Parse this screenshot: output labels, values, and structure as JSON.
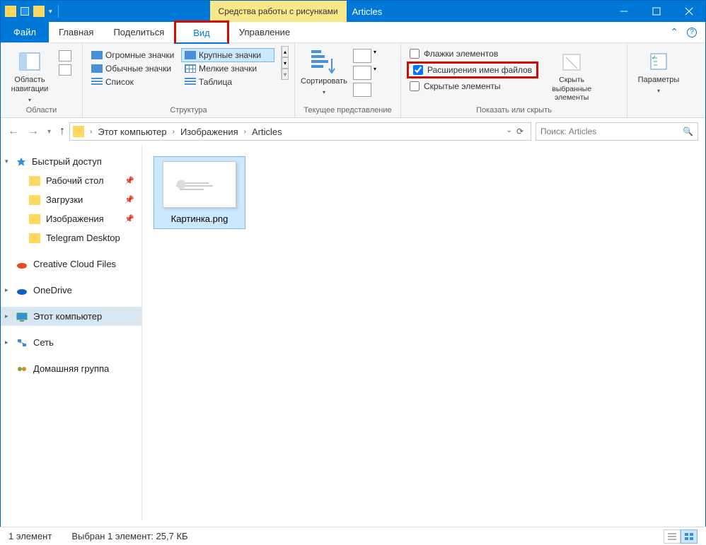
{
  "title_bar": {
    "context_label": "Средства работы с рисунками",
    "app_title": "Articles"
  },
  "tabs": {
    "file": "Файл",
    "home": "Главная",
    "share": "Поделиться",
    "view": "Вид",
    "manage": "Управление"
  },
  "ribbon": {
    "areas": {
      "nav_pane": "Область навигации",
      "group_label": "Области"
    },
    "layouts": {
      "huge": "Огромные значки",
      "large": "Крупные значки",
      "normal": "Обычные значки",
      "small": "Мелкие значки",
      "list": "Список",
      "table": "Таблица",
      "group_label": "Структура"
    },
    "current_view": {
      "sort": "Сортировать",
      "group_label": "Текущее представление"
    },
    "show_hide": {
      "item_checkboxes": "Флажки элементов",
      "file_ext": "Расширения имен файлов",
      "hidden": "Скрытые элементы",
      "hide_selected": "Скрыть выбранные элементы",
      "group_label": "Показать или скрыть"
    },
    "options": {
      "params": "Параметры"
    }
  },
  "breadcrumb": {
    "segs": [
      "Этот компьютер",
      "Изображения",
      "Articles"
    ]
  },
  "search": {
    "placeholder": "Поиск: Articles"
  },
  "sidebar": {
    "quick": "Быстрый доступ",
    "desktop": "Рабочий стол",
    "downloads": "Загрузки",
    "pictures": "Изображения",
    "telegram": "Telegram Desktop",
    "ccf": "Creative Cloud Files",
    "onedrive": "OneDrive",
    "thispc": "Этот компьютер",
    "network": "Сеть",
    "homegroup": "Домашняя группа"
  },
  "file_item": {
    "name": "Картинка.png"
  },
  "status": {
    "count": "1 элемент",
    "selection": "Выбран 1 элемент: 25,7 КБ"
  }
}
